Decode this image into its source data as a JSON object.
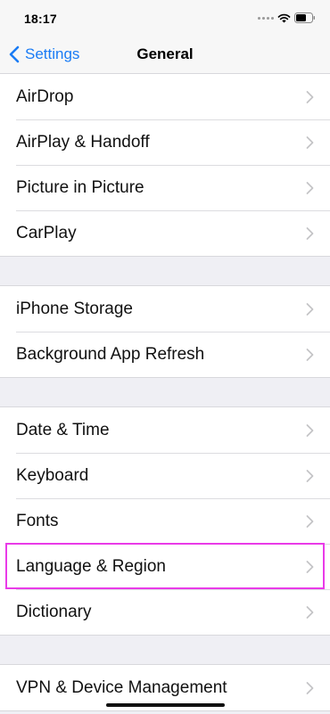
{
  "status_bar": {
    "time": "18:17",
    "icons": [
      "signal-dots-icon",
      "wifi-icon",
      "battery-icon"
    ]
  },
  "nav": {
    "back_label": "Settings",
    "title": "General",
    "accent_color": "#1a7cf5"
  },
  "groups": [
    {
      "items": [
        {
          "label": "AirDrop"
        },
        {
          "label": "AirPlay & Handoff"
        },
        {
          "label": "Picture in Picture"
        },
        {
          "label": "CarPlay"
        }
      ]
    },
    {
      "items": [
        {
          "label": "iPhone Storage"
        },
        {
          "label": "Background App Refresh"
        }
      ]
    },
    {
      "items": [
        {
          "label": "Date & Time"
        },
        {
          "label": "Keyboard"
        },
        {
          "label": "Fonts"
        },
        {
          "label": "Language & Region",
          "highlighted": true
        },
        {
          "label": "Dictionary"
        }
      ]
    },
    {
      "items": [
        {
          "label": "VPN & Device Management"
        }
      ]
    }
  ],
  "highlight_color": "#e93be8"
}
